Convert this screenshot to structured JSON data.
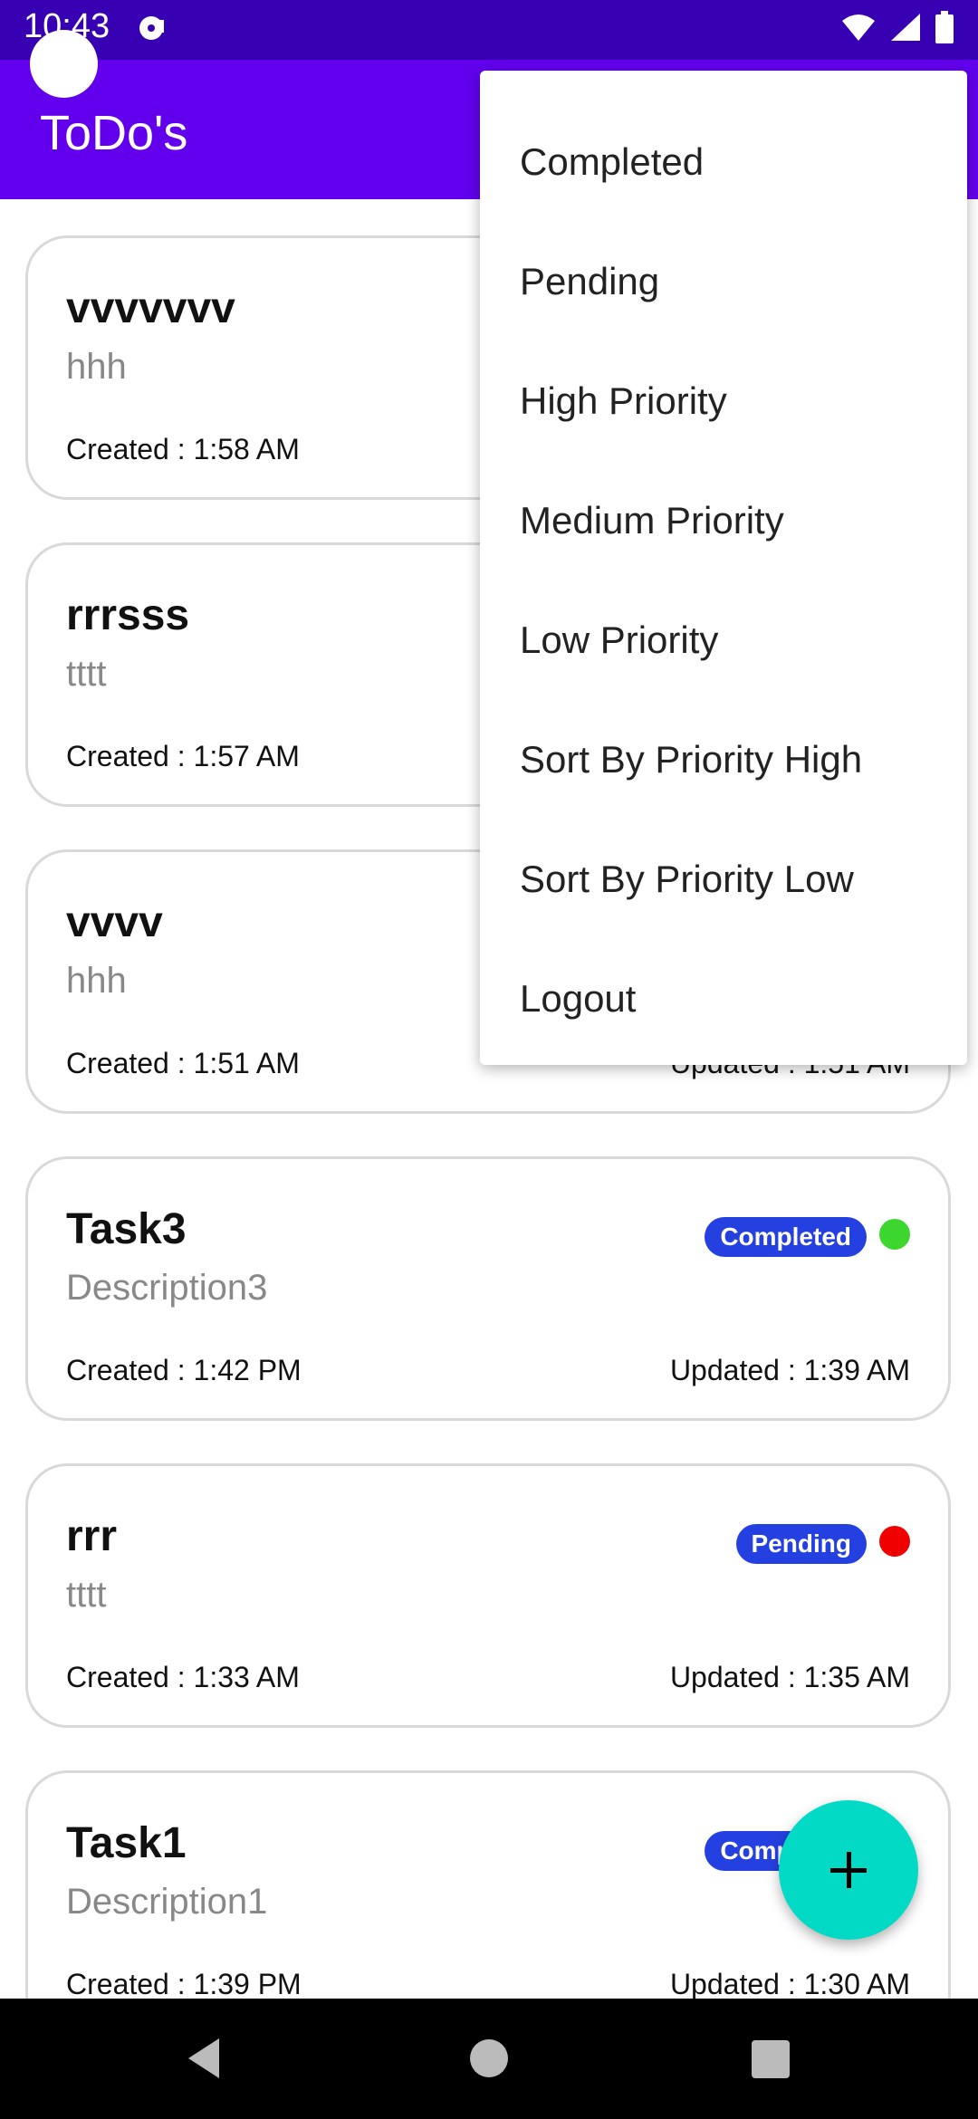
{
  "status_bar": {
    "time": "10:43",
    "icons": [
      "media-icon",
      "wifi-icon",
      "signal-icon",
      "battery-icon"
    ]
  },
  "app_bar": {
    "title": "ToDo's"
  },
  "tasks": [
    {
      "title": "vvvvvvv",
      "description": "hhh",
      "created": "Created : 1:58 AM",
      "updated": "",
      "status": "",
      "dot_color": ""
    },
    {
      "title": "rrrsss",
      "description": "tttt",
      "created": "Created : 1:57 AM",
      "updated": "",
      "status": "",
      "dot_color": ""
    },
    {
      "title": "vvvv",
      "description": "hhh",
      "created": "Created : 1:51 AM",
      "updated": "Updated : 1:51 AM",
      "status": "",
      "dot_color": ""
    },
    {
      "title": "Task3",
      "description": "Description3",
      "created": "Created : 1:42 PM",
      "updated": "Updated : 1:39 AM",
      "status": "Completed",
      "dot_color": "#3DD62F"
    },
    {
      "title": "rrr",
      "description": "tttt",
      "created": "Created : 1:33 AM",
      "updated": "Updated : 1:35 AM",
      "status": "Pending",
      "dot_color": "#F00000"
    },
    {
      "title": "Task1",
      "description": "Description1",
      "created": "Created : 1:39 PM",
      "updated": "Updated : 1:30 AM",
      "status": "Completed",
      "dot_color": ""
    }
  ],
  "menu": {
    "items": [
      "Completed",
      "Pending",
      "High Priority",
      "Medium Priority",
      "Low Priority",
      "Sort By Priority High",
      "Sort By Priority Low",
      "Logout"
    ]
  },
  "fab": {
    "icon": "plus-icon"
  },
  "nav_bar": {
    "icons": [
      "back-icon",
      "home-icon",
      "recents-icon"
    ]
  },
  "colors": {
    "status_bar": "#3700B3",
    "app_bar": "#6200EE",
    "badge": "#2540E0",
    "fab": "#03DAC5",
    "completed_dot": "#3DD62F",
    "pending_dot": "#F00000"
  }
}
